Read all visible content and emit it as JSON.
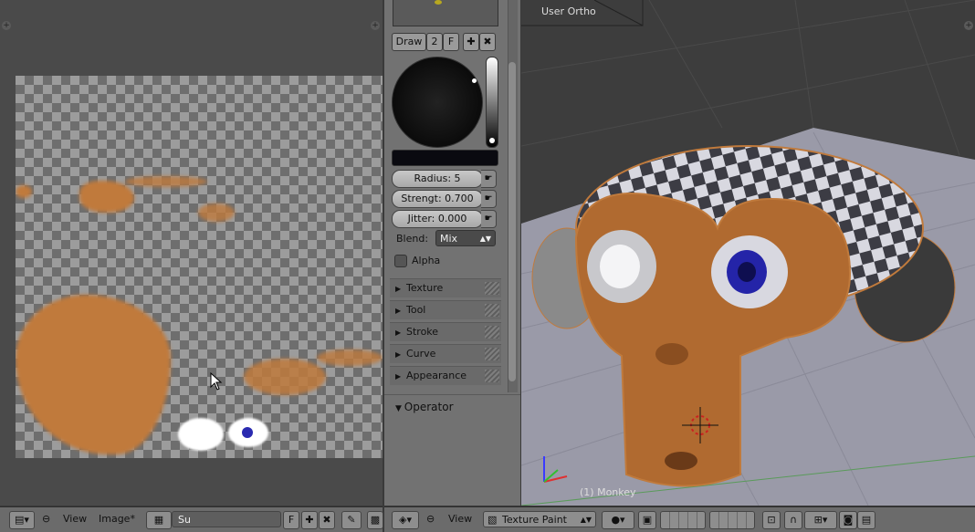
{
  "viewport": {
    "view_name": "User Ortho",
    "object_label": "(1) Monkey"
  },
  "tool_panel": {
    "paint_tabs": [
      "Draw",
      "2",
      "F"
    ],
    "radius_label": "Radius: 5",
    "strength_label": "Strengt: 0.700",
    "jitter_label": "Jitter: 0.000",
    "blend_label": "Blend:",
    "blend_value": "Mix",
    "alpha_label": "Alpha",
    "sections": [
      "Texture",
      "Tool",
      "Stroke",
      "Curve",
      "Appearance"
    ],
    "operator_label": "Operator"
  },
  "image_footer": {
    "view": "View",
    "image": "Image*",
    "image_name": "Su",
    "fake_user": "F"
  },
  "viewport_footer": {
    "view": "View",
    "mode": "Texture Paint"
  },
  "colors": {
    "accent_orange": "#c07a3c",
    "panel_gray": "#727272",
    "viewport_gray": "#3d3d3d",
    "grid_floor": "#9a9aa8"
  }
}
